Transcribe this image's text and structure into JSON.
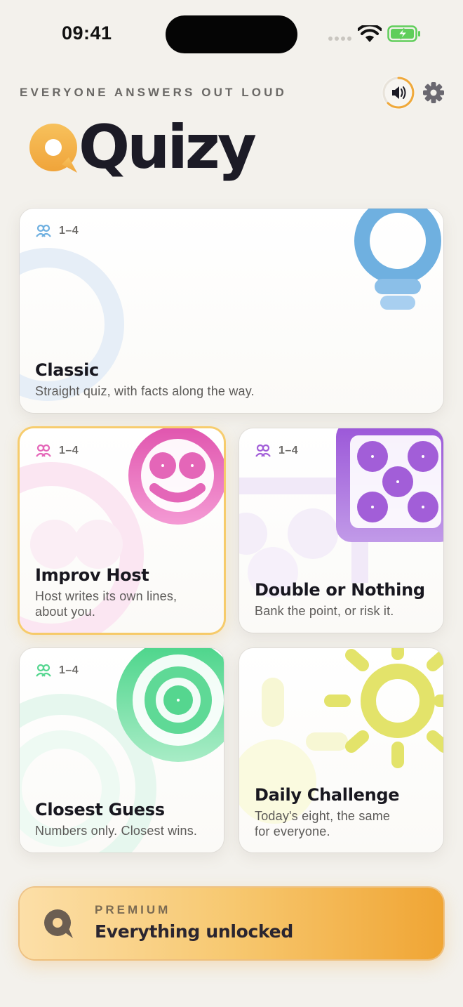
{
  "status_bar": {
    "time": "09:41"
  },
  "header": {
    "tagline": "EVERYONE ANSWERS OUT LOUD",
    "logo_text": "Quizy"
  },
  "modes": [
    {
      "id": "classic",
      "players": "1–4",
      "title": "Classic",
      "description": "Straight quiz, with facts along the way.",
      "accent": "#6fb0e0"
    },
    {
      "id": "improv-host",
      "players": "1–4",
      "title": "Improv Host",
      "description_line1": "Host writes its own lines,",
      "description_line2": "about you.",
      "accent": "#e466b8",
      "selected": true
    },
    {
      "id": "double-or-nothing",
      "players": "1–4",
      "title": "Double or Nothing",
      "description": "Bank the point, or risk it.",
      "accent": "#a25ed8"
    },
    {
      "id": "closest-guess",
      "players": "1–4",
      "title": "Closest Guess",
      "description": "Numbers only. Closest wins.",
      "accent": "#55d68f"
    },
    {
      "id": "daily-challenge",
      "title": "Daily Challenge",
      "description_line1": "Today's eight, the same",
      "description_line2": "for everyone.",
      "accent": "#e3e36a"
    }
  ],
  "premium": {
    "kicker": "PREMIUM",
    "title": "Everything unlocked",
    "accent_start": "#fcdfa8",
    "accent_end": "#f0a534"
  },
  "icons": [
    "wifi-icon",
    "battery-charging-icon",
    "speaker-icon",
    "gear-icon",
    "players-icon",
    "logo-q-icon"
  ]
}
